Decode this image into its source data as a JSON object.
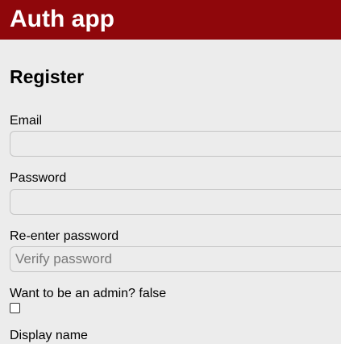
{
  "header": {
    "title": "Auth app",
    "background": "#8f070b"
  },
  "form": {
    "heading": "Register",
    "email": {
      "label": "Email",
      "value": "",
      "placeholder": ""
    },
    "password": {
      "label": "Password",
      "value": "",
      "placeholder": ""
    },
    "reenter_password": {
      "label": "Re-enter password",
      "value": "",
      "placeholder": "Verify password"
    },
    "admin": {
      "label": "Want to be an admin? false",
      "checked": false
    },
    "display_name": {
      "label": "Display name"
    }
  }
}
